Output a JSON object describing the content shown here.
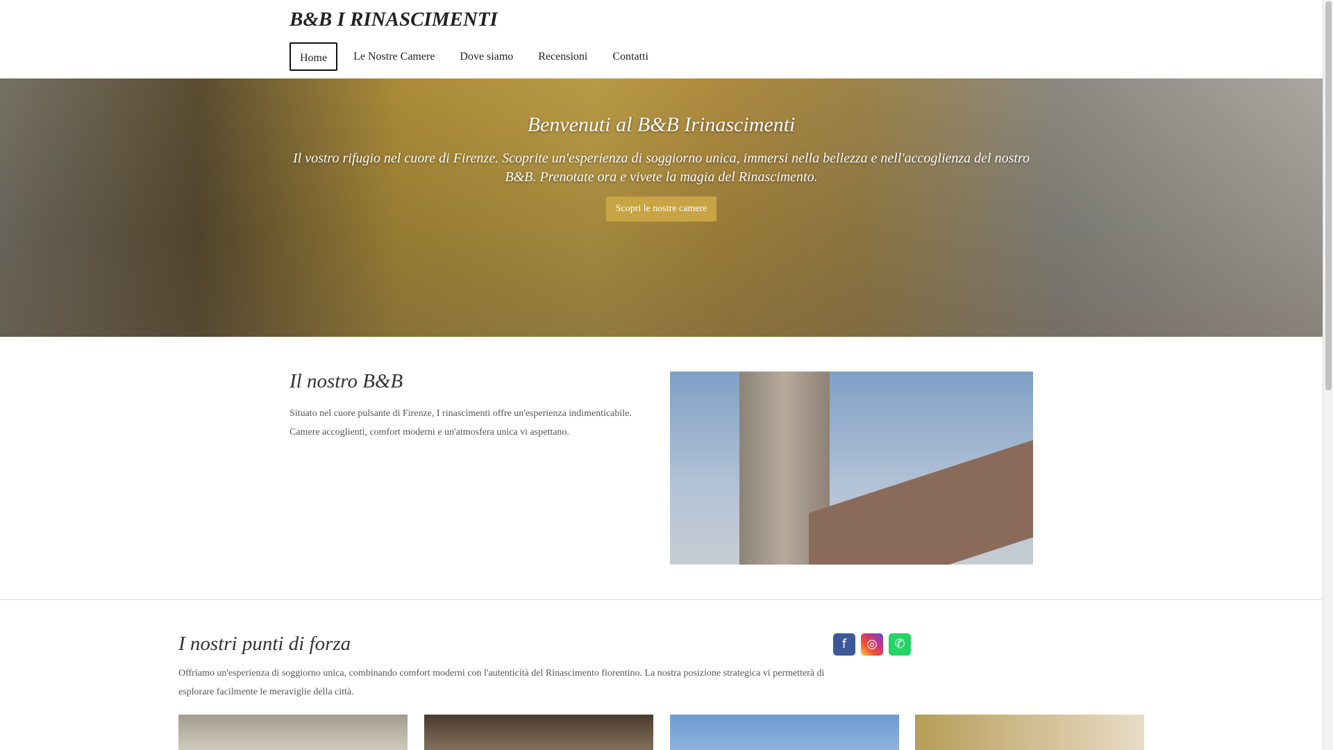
{
  "header": {
    "brand": "B&B I RINASCIMENTI",
    "nav": [
      "Home",
      "Le Nostre Camere",
      "Dove siamo",
      "Recensioni",
      "Contatti"
    ]
  },
  "hero": {
    "title": "Benvenuti al B&B Irinascimenti",
    "subtitle": "Il vostro rifugio nel cuore di Firenze. Scoprite un'esperienza di soggiorno unica, immersi nella bellezza e nell'accoglienza del nostro B&B. Prenotate ora e vivete la magia del Rinascimento.",
    "button": "Scopri le nostre camere"
  },
  "about": {
    "title": "Il nostro B&B",
    "text": "Situato nel cuore pulsante di Firenze, I rinascimenti offre un'esperienza indimenticabile. Camere accoglienti, comfort moderni e un'atmosfera unica vi aspettano."
  },
  "strengths": {
    "title": "I nostri punti di forza",
    "text": "Offriamo un'esperienza di soggiorno unica, combinando comfort moderni con l'autenticità del Rinascimento fiorentino. La nostra posizione strategica vi permetterà di esplorare facilmente le meraviglie della città."
  },
  "social": [
    {
      "icon": "facebook-icon",
      "color": "#3b5998"
    },
    {
      "icon": "instagram-icon",
      "color": "#c13584"
    },
    {
      "icon": "whatsapp-icon",
      "color": "#25d366"
    }
  ]
}
